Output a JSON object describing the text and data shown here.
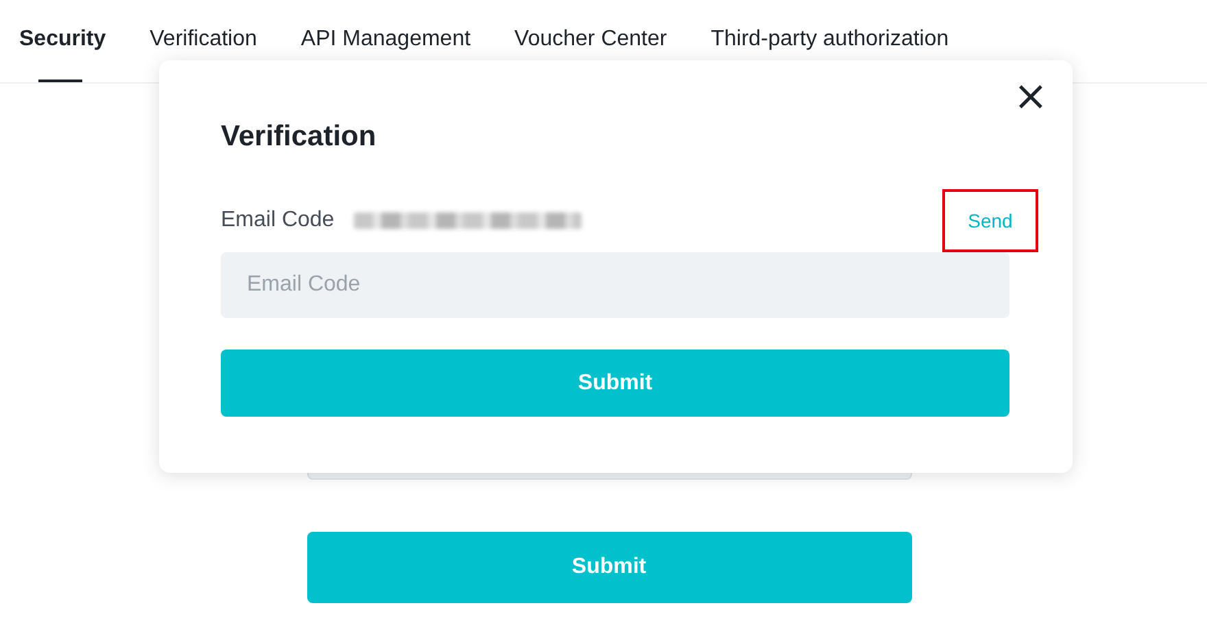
{
  "tabs": [
    {
      "label": "Security",
      "selected": true
    },
    {
      "label": "Verification",
      "selected": false
    },
    {
      "label": "API Management",
      "selected": false
    },
    {
      "label": "Voucher Center",
      "selected": false
    },
    {
      "label": "Third-party authorization",
      "selected": false
    }
  ],
  "background_form": {
    "submit_label": "Submit"
  },
  "dialog": {
    "title": "Verification",
    "close": "×",
    "email_label": "Email Code",
    "email_redacted": true,
    "send": {
      "label": "Send",
      "highlighted": true
    },
    "code_field": {
      "placeholder": "Email Code"
    },
    "submit_label": "Submit"
  }
}
